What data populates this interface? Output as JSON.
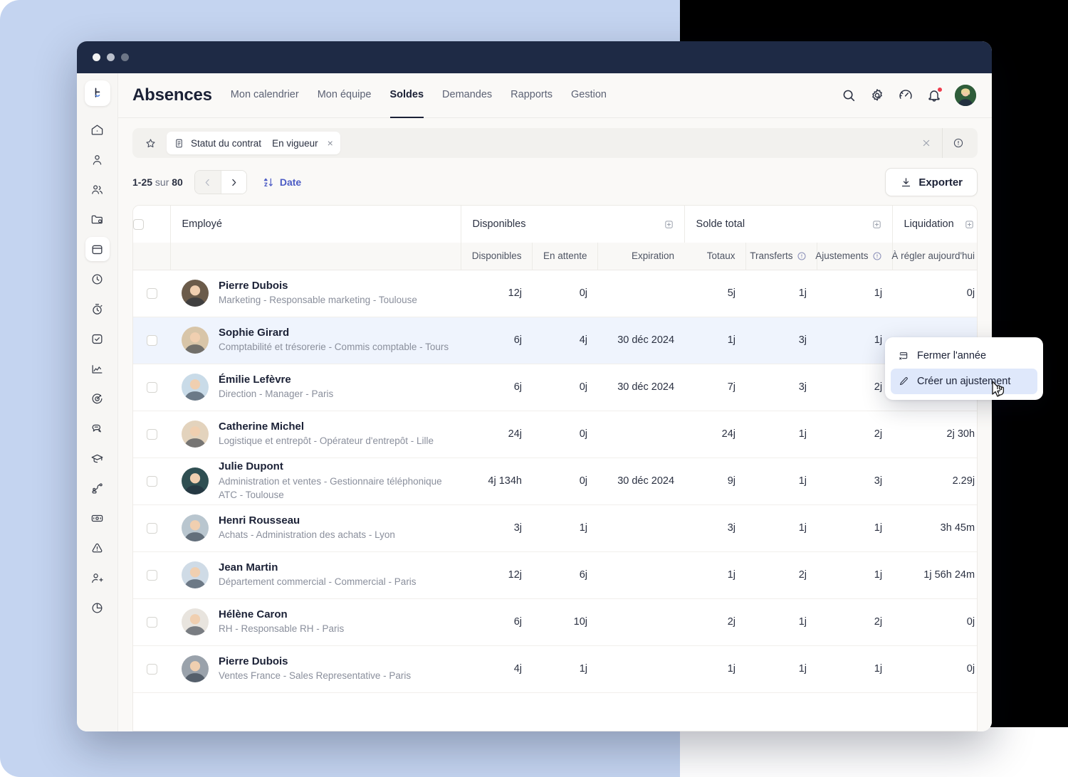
{
  "window": {
    "dots": [
      "close",
      "minimize",
      "maximize"
    ]
  },
  "rail": {
    "logo": "factorial-logo",
    "items": [
      {
        "name": "home",
        "icon": "home-icon",
        "active": false
      },
      {
        "name": "profile",
        "icon": "person-icon",
        "active": false
      },
      {
        "name": "people",
        "icon": "people-icon",
        "active": false
      },
      {
        "name": "documents",
        "icon": "folder-icon",
        "active": false
      },
      {
        "name": "absences",
        "icon": "calendar-icon",
        "active": true
      },
      {
        "name": "time",
        "icon": "clock-icon",
        "active": false
      },
      {
        "name": "timer",
        "icon": "stopwatch-icon",
        "active": false
      },
      {
        "name": "tasks",
        "icon": "check-square-icon",
        "active": false
      },
      {
        "name": "analytics",
        "icon": "chart-line-icon",
        "active": false
      },
      {
        "name": "goals",
        "icon": "target-icon",
        "active": false
      },
      {
        "name": "feedback",
        "icon": "chat-icon",
        "active": false
      },
      {
        "name": "training",
        "icon": "graduation-cap-icon",
        "active": false
      },
      {
        "name": "workflows",
        "icon": "flow-icon",
        "active": false
      },
      {
        "name": "payroll",
        "icon": "money-icon",
        "active": false
      },
      {
        "name": "alerts",
        "icon": "warning-icon",
        "active": false
      },
      {
        "name": "recruiting",
        "icon": "person-add-icon",
        "active": false
      },
      {
        "name": "reports",
        "icon": "pie-chart-icon",
        "active": false
      }
    ]
  },
  "topnav": {
    "brand": "Absences",
    "tabs": [
      {
        "label": "Mon calendrier",
        "active": false
      },
      {
        "label": "Mon équipe",
        "active": false
      },
      {
        "label": "Soldes",
        "active": true
      },
      {
        "label": "Demandes",
        "active": false
      },
      {
        "label": "Rapports",
        "active": false
      },
      {
        "label": "Gestion",
        "active": false
      }
    ],
    "actions": [
      {
        "name": "search-icon"
      },
      {
        "name": "gear-icon"
      },
      {
        "name": "speedometer-icon"
      },
      {
        "name": "bell-icon",
        "badge": true
      }
    ],
    "avatar": "user-avatar"
  },
  "filterbar": {
    "favorite_icon": "star-icon",
    "chip": {
      "icon": "contract-icon",
      "label": "Statut du contrat",
      "value": "En vigueur",
      "remove": "×"
    },
    "clear_icon": "close-icon",
    "info_icon": "info-circle-icon"
  },
  "toolbar": {
    "range": "1-25",
    "of_word": "sur",
    "total": "80",
    "prev_icon": "chevron-left-icon",
    "next_icon": "chevron-right-icon",
    "sort_icon": "sort-az-icon",
    "sort_label": "Date",
    "export_icon": "download-icon",
    "export_label": "Exporter"
  },
  "table": {
    "group_headers": [
      {
        "label": "Employé",
        "plus": false
      },
      {
        "label": "Disponibles",
        "plus": true
      },
      {
        "label": "Solde total",
        "plus": true
      },
      {
        "label": "Liquidation",
        "plus": true
      }
    ],
    "sub_headers": [
      {
        "label": "Disponibles",
        "info": false
      },
      {
        "label": "En attente",
        "info": false
      },
      {
        "label": "Expiration",
        "info": false
      },
      {
        "label": "Totaux",
        "info": false
      },
      {
        "label": "Transferts",
        "info": true
      },
      {
        "label": "Ajustements",
        "info": true
      },
      {
        "label": "À régler aujourd'hui",
        "info": false
      }
    ],
    "rows": [
      {
        "name": "Pierre Dubois",
        "role": "Marketing - Responsable marketing - Toulouse",
        "disponibles": "12j",
        "en_attente": "0j",
        "expiration": "",
        "totaux": "5j",
        "transferts": "1j",
        "ajustements": "1j",
        "a_regler": "0j",
        "highlight": false,
        "avatar": "#6b5b4a"
      },
      {
        "name": "Sophie Girard",
        "role": "Comptabilité et trésorerie - Commis comptable - Tours",
        "disponibles": "6j",
        "en_attente": "4j",
        "expiration": "30 déc 2024",
        "totaux": "1j",
        "transferts": "3j",
        "ajustements": "1j",
        "a_regler": "",
        "highlight": true,
        "avatar": "#d8c5a8"
      },
      {
        "name": "Émilie Lefèvre",
        "role": "Direction - Manager - Paris",
        "disponibles": "6j",
        "en_attente": "0j",
        "expiration": "30 déc 2024",
        "totaux": "7j",
        "transferts": "3j",
        "ajustements": "2j",
        "a_regler": "",
        "highlight": false,
        "avatar": "#c9dbe8"
      },
      {
        "name": "Catherine Michel",
        "role": "Logistique et entrepôt - Opérateur d'entrepôt - Lille",
        "disponibles": "24j",
        "en_attente": "0j",
        "expiration": "",
        "totaux": "24j",
        "transferts": "1j",
        "ajustements": "2j",
        "a_regler": "2j 30h",
        "highlight": false,
        "avatar": "#e3d3bd"
      },
      {
        "name": "Julie Dupont",
        "role": "Administration et ventes - Gestionnaire téléphonique ATC - Toulouse",
        "disponibles": "4j 134h",
        "en_attente": "0j",
        "expiration": "30 déc 2024",
        "totaux": "9j",
        "transferts": "1j",
        "ajustements": "3j",
        "a_regler": "2.29j",
        "highlight": false,
        "avatar": "#2f4f52"
      },
      {
        "name": "Henri Rousseau",
        "role": "Achats - Administration des achats - Lyon",
        "disponibles": "3j",
        "en_attente": "1j",
        "expiration": "",
        "totaux": "3j",
        "transferts": "1j",
        "ajustements": "1j",
        "a_regler": "3h 45m",
        "highlight": false,
        "avatar": "#b9c6cf"
      },
      {
        "name": "Jean Martin",
        "role": "Département commercial - Commercial - Paris",
        "disponibles": "12j",
        "en_attente": "6j",
        "expiration": "",
        "totaux": "1j",
        "transferts": "2j",
        "ajustements": "1j",
        "a_regler": "1j 56h 24m",
        "highlight": false,
        "avatar": "#cfdbe6"
      },
      {
        "name": "Hélène Caron",
        "role": "RH - Responsable RH - Paris",
        "disponibles": "6j",
        "en_attente": "10j",
        "expiration": "",
        "totaux": "2j",
        "transferts": "1j",
        "ajustements": "2j",
        "a_regler": "0j",
        "highlight": false,
        "avatar": "#e8e4de"
      },
      {
        "name": "Pierre Dubois",
        "role": "Ventes France - Sales Representative - Paris",
        "disponibles": "4j",
        "en_attente": "1j",
        "expiration": "",
        "totaux": "1j",
        "transferts": "1j",
        "ajustements": "1j",
        "a_regler": "0j",
        "highlight": false,
        "avatar": "#9aa2ab"
      }
    ]
  },
  "context_menu": {
    "items": [
      {
        "label": "Fermer l'année",
        "icon": "calendar-close-icon",
        "selected": false
      },
      {
        "label": "Créer un ajustement",
        "icon": "pencil-icon",
        "selected": true
      }
    ]
  },
  "colors": {
    "accent": "#4c5cc5",
    "titlebar": "#1e2a45",
    "row_highlight": "#eff4fd",
    "menu_selected": "#dfe8fb",
    "notification": "#ef3d4e",
    "backdrop": "#c4d4f0"
  }
}
